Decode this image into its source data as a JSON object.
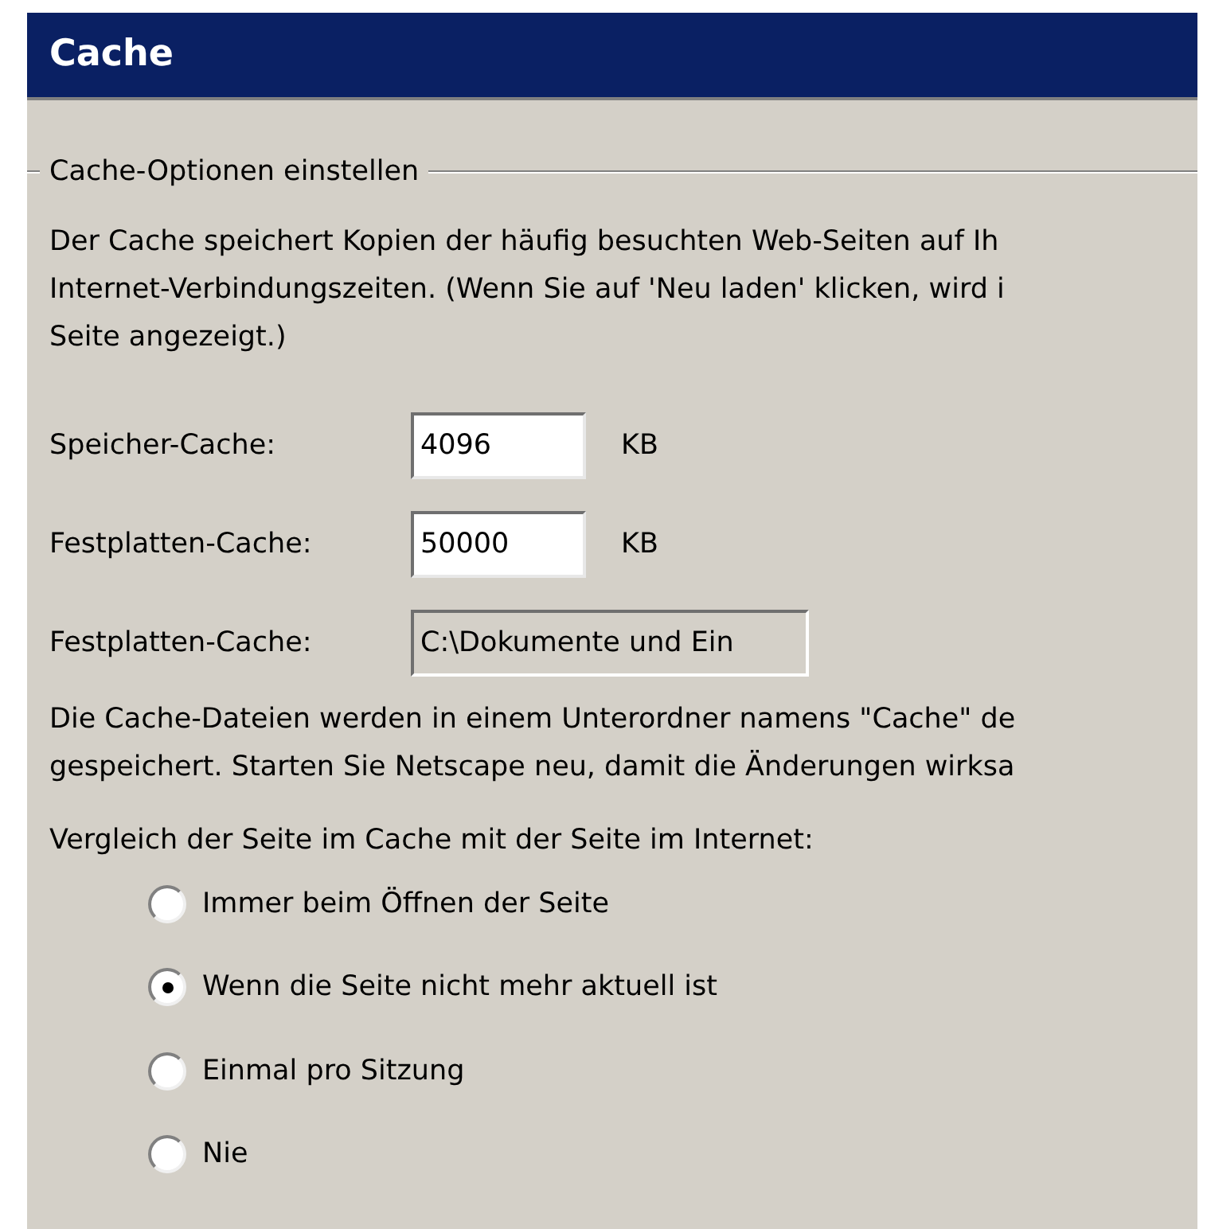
{
  "title": "Cache",
  "group": {
    "label": "Cache-Optionen einstellen"
  },
  "intro_lines": [
    "Der Cache speichert Kopien der häufig besuchten Web-Seiten auf Ih",
    "Internet-Verbindungszeiten. (Wenn Sie auf 'Neu laden' klicken, wird i",
    "Seite angezeigt.)"
  ],
  "fields": [
    {
      "label": "Speicher-Cache:",
      "value": "4096",
      "unit": "KB",
      "disabled": false
    },
    {
      "label": "Festplatten-Cache:",
      "value": "50000",
      "unit": "KB",
      "disabled": false
    },
    {
      "label": "Festplatten-Cache:",
      "value": "C:\\Dokumente und Ein",
      "disabled": true
    }
  ],
  "folder_lines": [
    "Die Cache-Dateien werden in einem Unterordner namens \"Cache\" de",
    "gespeichert. Starten Sie Netscape neu, damit die Änderungen wirksa"
  ],
  "compare": {
    "label": "Vergleich der Seite im Cache mit der Seite im Internet:",
    "options": [
      {
        "label": "Immer beim Öffnen der Seite",
        "selected": false
      },
      {
        "label": "Wenn die Seite nicht mehr aktuell ist",
        "selected": true
      },
      {
        "label": "Einmal pro Sitzung",
        "selected": false
      },
      {
        "label": "Nie",
        "selected": false
      }
    ]
  }
}
